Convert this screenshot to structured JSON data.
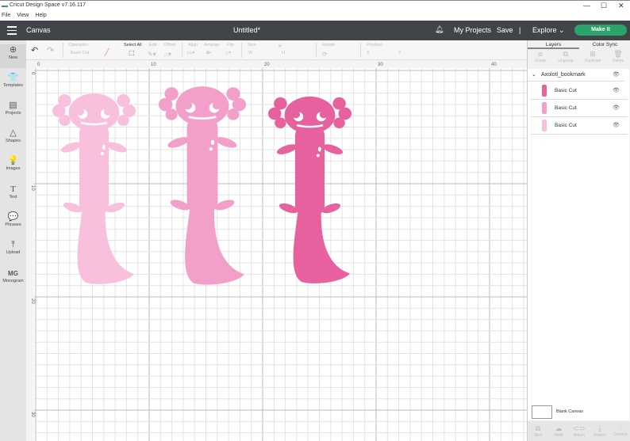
{
  "window": {
    "title": "Cricut Design Space  v7.16.117",
    "minimize": "—",
    "maximize": "☐",
    "close": "✕"
  },
  "menu": [
    "File",
    "View",
    "Help"
  ],
  "header": {
    "section": "Canvas",
    "doc_title": "Untitled*",
    "my_projects": "My Projects",
    "save": "Save",
    "divider": "|",
    "explore": "Explore",
    "make_it": "Make It"
  },
  "toolbar": {
    "operation_label": "Operation",
    "operation_value": "Basic Cut",
    "select_all": "Select All",
    "edit": "Edit",
    "offset": "Offset",
    "align": "Align",
    "arrange": "Arrange",
    "flip": "Flip",
    "size": "Size",
    "w": "W",
    "h": "H",
    "rotate": "Rotate",
    "position": "Position",
    "x": "X",
    "y": "Y"
  },
  "sidebar": [
    {
      "label": "New",
      "icon": "⊕"
    },
    {
      "label": "Templates",
      "icon": "👕"
    },
    {
      "label": "Projects",
      "icon": "▤"
    },
    {
      "label": "Shapes",
      "icon": "△"
    },
    {
      "label": "Images",
      "icon": "💡"
    },
    {
      "label": "Text",
      "icon": "T"
    },
    {
      "label": "Phrases",
      "icon": "💬"
    },
    {
      "label": "Upload",
      "icon": "⤒"
    },
    {
      "label": "Monogram",
      "icon": "MG"
    }
  ],
  "ruler": {
    "h": [
      "0",
      "10",
      "20",
      "30",
      "40"
    ],
    "v": [
      "0",
      "10",
      "20",
      "30"
    ]
  },
  "colors": {
    "light": "#f8c0dc",
    "mid": "#f2a0c9",
    "hot": "#e7619f",
    "outline": "#7b5468"
  },
  "layers": {
    "tabs": [
      "Layers",
      "Color Sync"
    ],
    "actions": [
      "Group",
      "Ungroup",
      "Duplicate",
      "Delete"
    ],
    "group_name": "Axolotl_bookmark",
    "items": [
      {
        "name": "Basic Cut",
        "color": "#e7619f"
      },
      {
        "name": "Basic Cut",
        "color": "#f2a0c9"
      },
      {
        "name": "Basic Cut",
        "color": "#f8c0dc"
      }
    ],
    "blank_canvas": "Blank Canvas",
    "bottom_actions": [
      "Slice",
      "Weld",
      "Attach",
      "Flatten",
      "Contour"
    ]
  }
}
